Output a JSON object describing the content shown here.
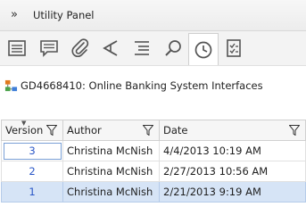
{
  "panel": {
    "chevron": "»",
    "title": "Utility Panel"
  },
  "toolbar": {
    "buttons": [
      {
        "icon": "properties-icon"
      },
      {
        "icon": "comments-icon"
      },
      {
        "icon": "attachment-icon"
      },
      {
        "icon": "share-icon"
      },
      {
        "icon": "list-icon"
      },
      {
        "icon": "search-icon"
      },
      {
        "icon": "history-icon",
        "active": true
      },
      {
        "icon": "checklist-icon"
      }
    ]
  },
  "item": {
    "icon": "requirement-icon",
    "title": "GD4668410: Online Banking System Interfaces"
  },
  "grid": {
    "headers": {
      "version": "Version",
      "author": "Author",
      "date": "Date"
    },
    "rows": [
      {
        "version": "3",
        "author": "Christina McNish",
        "date": "4/4/2013 10:19 AM"
      },
      {
        "version": "2",
        "author": "Christina McNish",
        "date": "2/27/2013 10:56 AM"
      },
      {
        "version": "1",
        "author": "Christina McNish",
        "date": "2/21/2013 9:19 AM",
        "selected": true
      }
    ]
  },
  "colors": {
    "link": "#2a57c7",
    "selected_row": "#d6e4f6"
  }
}
